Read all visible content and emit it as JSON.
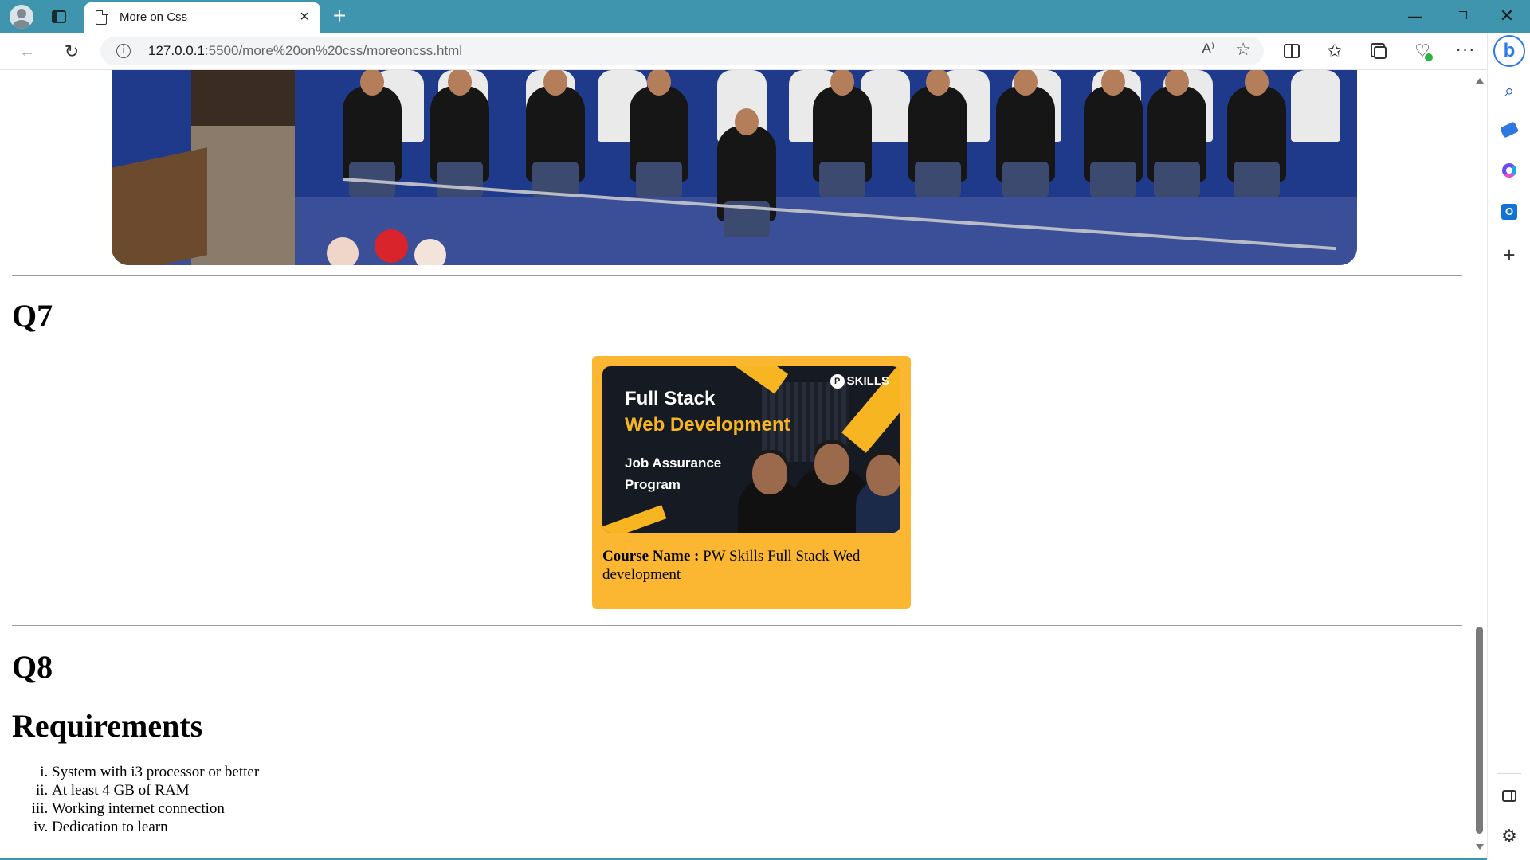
{
  "browser": {
    "tab_title": "More on Css",
    "new_tab_symbol": "+",
    "close_tab_symbol": "×",
    "url_host": "127.0.0.1",
    "url_path": ":5500/more%20on%20css/moreoncss.html",
    "read_aloud": "A⁾",
    "favorite_star": "☆",
    "back": "←",
    "reload": "↻",
    "favorites": "✩",
    "health": "♡",
    "more": "···",
    "minimize": "—",
    "close": "✕"
  },
  "sidebar": {
    "bing_label": "b",
    "search": "⌕",
    "add": "+",
    "settings": "⚙",
    "outlook": "O"
  },
  "page": {
    "q7_heading": "Q7",
    "q8_heading": "Q8",
    "requirements_heading": "Requirements",
    "course_card": {
      "banner_brand": "SKILLS",
      "banner_line1": "Full Stack",
      "banner_line2": "Web Development",
      "banner_line3": "Job Assurance Program",
      "caption_label": "Course Name :",
      "caption_value": " PW Skills Full Stack Wed development"
    },
    "requirements": [
      "System with i3 processor or better",
      "At least 4 GB of RAM",
      "Working internet connection",
      "Dedication to learn"
    ]
  },
  "colors": {
    "titlebar": "#3f95ae",
    "card_bg": "#fbb731",
    "banner_bg": "#161a22",
    "banner_accent": "#f6b521",
    "bing_blue": "#2e7be6"
  }
}
